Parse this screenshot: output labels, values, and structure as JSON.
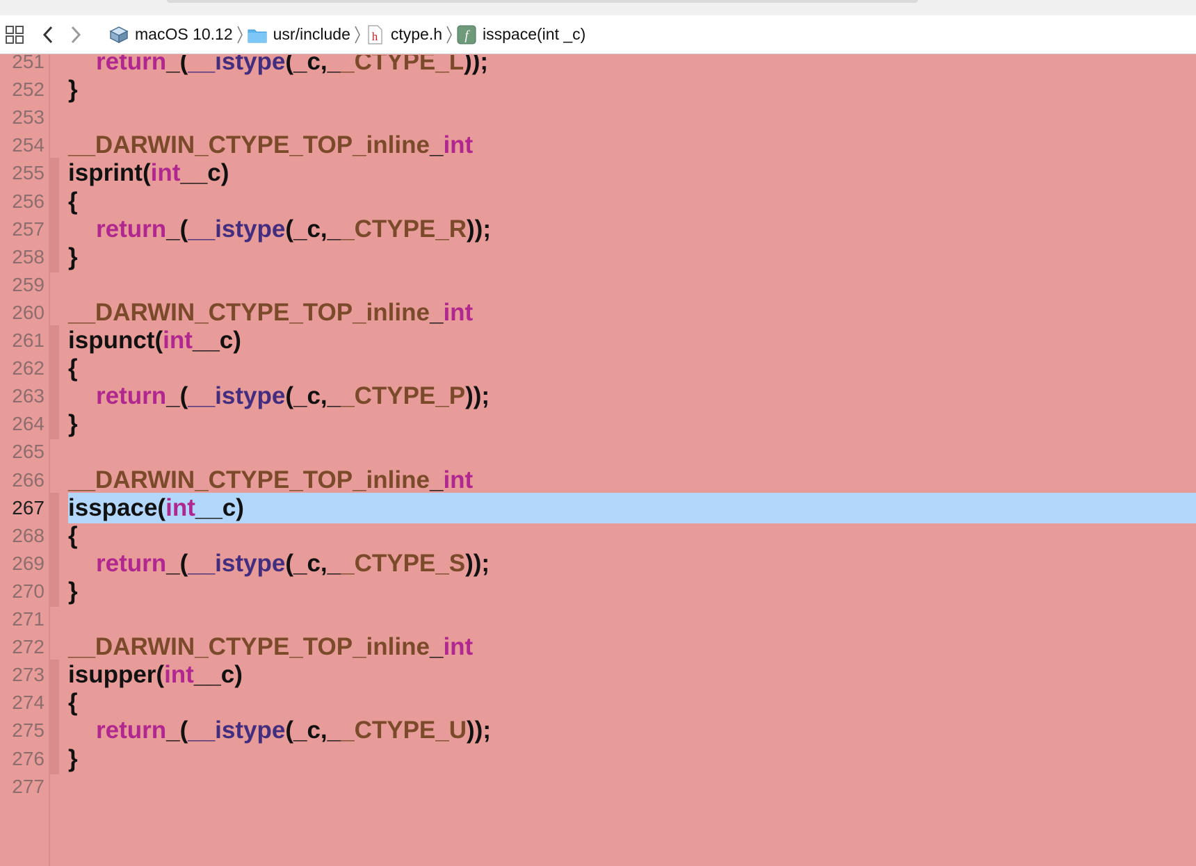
{
  "window": {
    "title": "isspace(int _c)"
  },
  "jump_bar": {
    "crumbs": [
      {
        "label": "macOS 10.12",
        "icon": "sdk-icon"
      },
      {
        "label": "usr/include",
        "icon": "folder-icon"
      },
      {
        "label": "ctype.h",
        "icon": "header-file-icon"
      },
      {
        "label": "isspace(int _c)",
        "icon": "function-icon"
      }
    ],
    "separator": "〉"
  },
  "colors": {
    "editor_background": "#e89c99",
    "highlight": "#b3d7fb",
    "keyword": "#b0288f",
    "macro": "#7a4a2b",
    "function": "#432d7e",
    "plain": "#111111"
  },
  "editor": {
    "current_line": "267",
    "lines": [
      {
        "num": "251",
        "tokens": [
          {
            "t": "kw",
            "v": "return"
          },
          {
            "t": "pl",
            "v": "_("
          },
          {
            "t": "fn",
            "v": "__istype"
          },
          {
            "t": "pl",
            "v": "(_c,_"
          },
          {
            "t": "mac",
            "v": "_CTYPE_L"
          },
          {
            "t": "pl",
            "v": "));"
          }
        ]
      },
      {
        "num": "252",
        "tokens": [
          {
            "t": "pl",
            "v": "}"
          }
        ]
      },
      {
        "num": "253",
        "tokens": []
      },
      {
        "num": "254",
        "tokens": [
          {
            "t": "mac",
            "v": "__DARWIN_CTYPE_TOP_inline"
          },
          {
            "t": "pl",
            "v": "_"
          },
          {
            "t": "kw",
            "v": "int"
          }
        ]
      },
      {
        "num": "255",
        "tokens": [
          {
            "t": "pl",
            "v": "isprint("
          },
          {
            "t": "kw",
            "v": "int"
          },
          {
            "t": "pl",
            "v": "__c)"
          }
        ]
      },
      {
        "num": "256",
        "tokens": [
          {
            "t": "pl",
            "v": "{"
          }
        ]
      },
      {
        "num": "257",
        "tokens": [
          {
            "t": "kw",
            "v": "return"
          },
          {
            "t": "pl",
            "v": "_("
          },
          {
            "t": "fn",
            "v": "__istype"
          },
          {
            "t": "pl",
            "v": "(_c,_"
          },
          {
            "t": "mac",
            "v": "_CTYPE_R"
          },
          {
            "t": "pl",
            "v": "));"
          }
        ]
      },
      {
        "num": "258",
        "tokens": [
          {
            "t": "pl",
            "v": "}"
          }
        ]
      },
      {
        "num": "259",
        "tokens": []
      },
      {
        "num": "260",
        "tokens": [
          {
            "t": "mac",
            "v": "__DARWIN_CTYPE_TOP_inline"
          },
          {
            "t": "pl",
            "v": "_"
          },
          {
            "t": "kw",
            "v": "int"
          }
        ]
      },
      {
        "num": "261",
        "tokens": [
          {
            "t": "pl",
            "v": "ispunct("
          },
          {
            "t": "kw",
            "v": "int"
          },
          {
            "t": "pl",
            "v": "__c)"
          }
        ]
      },
      {
        "num": "262",
        "tokens": [
          {
            "t": "pl",
            "v": "{"
          }
        ]
      },
      {
        "num": "263",
        "tokens": [
          {
            "t": "kw",
            "v": "return"
          },
          {
            "t": "pl",
            "v": "_("
          },
          {
            "t": "fn",
            "v": "__istype"
          },
          {
            "t": "pl",
            "v": "(_c,_"
          },
          {
            "t": "mac",
            "v": "_CTYPE_P"
          },
          {
            "t": "pl",
            "v": "));"
          }
        ]
      },
      {
        "num": "264",
        "tokens": [
          {
            "t": "pl",
            "v": "}"
          }
        ]
      },
      {
        "num": "265",
        "tokens": []
      },
      {
        "num": "266",
        "tokens": [
          {
            "t": "mac",
            "v": "__DARWIN_CTYPE_TOP_inline"
          },
          {
            "t": "pl",
            "v": "_"
          },
          {
            "t": "kw",
            "v": "int"
          }
        ]
      },
      {
        "num": "267",
        "tokens": [
          {
            "t": "pl",
            "v": "isspace("
          },
          {
            "t": "kw",
            "v": "int"
          },
          {
            "t": "pl",
            "v": "__c)"
          }
        ]
      },
      {
        "num": "268",
        "tokens": [
          {
            "t": "pl",
            "v": "{"
          }
        ]
      },
      {
        "num": "269",
        "tokens": [
          {
            "t": "kw",
            "v": "return"
          },
          {
            "t": "pl",
            "v": "_("
          },
          {
            "t": "fn",
            "v": "__istype"
          },
          {
            "t": "pl",
            "v": "(_c,_"
          },
          {
            "t": "mac",
            "v": "_CTYPE_S"
          },
          {
            "t": "pl",
            "v": "));"
          }
        ]
      },
      {
        "num": "270",
        "tokens": [
          {
            "t": "pl",
            "v": "}"
          }
        ]
      },
      {
        "num": "271",
        "tokens": []
      },
      {
        "num": "272",
        "tokens": [
          {
            "t": "mac",
            "v": "__DARWIN_CTYPE_TOP_inline"
          },
          {
            "t": "pl",
            "v": "_"
          },
          {
            "t": "kw",
            "v": "int"
          }
        ]
      },
      {
        "num": "273",
        "tokens": [
          {
            "t": "pl",
            "v": "isupper("
          },
          {
            "t": "kw",
            "v": "int"
          },
          {
            "t": "pl",
            "v": "__c)"
          }
        ]
      },
      {
        "num": "274",
        "tokens": [
          {
            "t": "pl",
            "v": "{"
          }
        ]
      },
      {
        "num": "275",
        "tokens": [
          {
            "t": "kw",
            "v": "return"
          },
          {
            "t": "pl",
            "v": "_("
          },
          {
            "t": "fn",
            "v": "__istype"
          },
          {
            "t": "pl",
            "v": "(_c,_"
          },
          {
            "t": "mac",
            "v": "_CTYPE_U"
          },
          {
            "t": "pl",
            "v": "));"
          }
        ]
      },
      {
        "num": "276",
        "tokens": [
          {
            "t": "pl",
            "v": "}"
          }
        ]
      },
      {
        "num": "277",
        "tokens": []
      }
    ]
  }
}
